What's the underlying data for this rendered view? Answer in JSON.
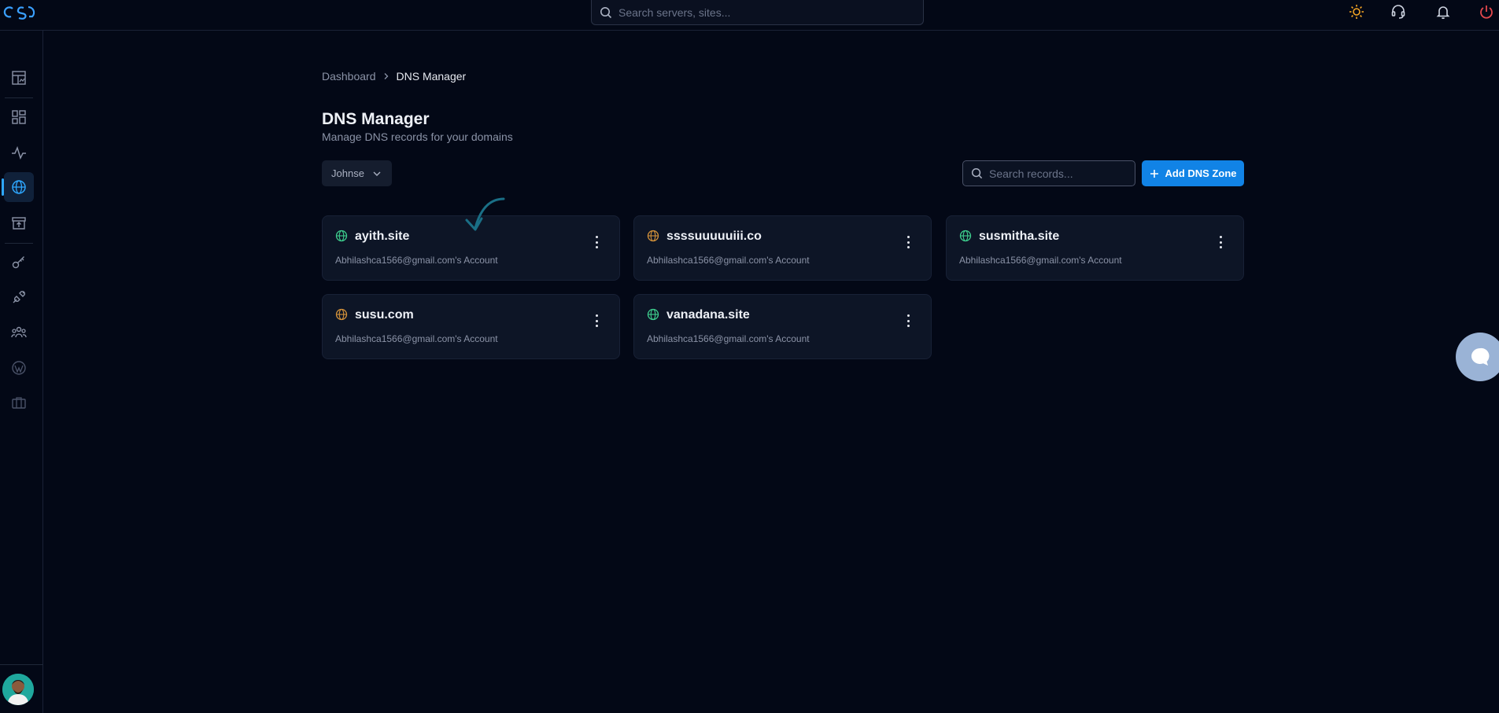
{
  "topbar": {
    "search_placeholder": "Search servers, sites...",
    "icons": [
      "sun-icon",
      "headset-icon",
      "bell-icon",
      "power-icon"
    ]
  },
  "sidebar": {
    "items": [
      {
        "name": "reports",
        "icon": "chart-board-icon"
      },
      {
        "name": "dashboard",
        "icon": "grid-icon"
      },
      {
        "name": "monitoring",
        "icon": "activity-icon"
      },
      {
        "name": "dns",
        "icon": "globe-icon",
        "active": true
      },
      {
        "name": "backups",
        "icon": "archive-upload-icon"
      },
      {
        "name": "keys",
        "icon": "key-icon"
      },
      {
        "name": "integrations",
        "icon": "plug-icon"
      },
      {
        "name": "team",
        "icon": "users-icon"
      },
      {
        "name": "wordpress",
        "icon": "wordpress-icon"
      },
      {
        "name": "briefcase",
        "icon": "briefcase-icon"
      }
    ]
  },
  "breadcrumb": {
    "home": "Dashboard",
    "current": "DNS Manager"
  },
  "page": {
    "title": "DNS Manager",
    "subtitle": "Manage DNS records for your domains"
  },
  "toolbar": {
    "filter_value": "Johnse",
    "search_placeholder": "Search records...",
    "add_label": "Add DNS Zone"
  },
  "zones": [
    {
      "domain": "ayith.site",
      "account": "Abhilashca1566@gmail.com's Account",
      "status_color": "#3ecf8e"
    },
    {
      "domain": "ssssuuuuuiii.co",
      "account": "Abhilashca1566@gmail.com's Account",
      "status_color": "#d4923a"
    },
    {
      "domain": "susmitha.site",
      "account": "Abhilashca1566@gmail.com's Account",
      "status_color": "#3ecf8e"
    },
    {
      "domain": "susu.com",
      "account": "Abhilashca1566@gmail.com's Account",
      "status_color": "#d4923a"
    },
    {
      "domain": "vanadana.site",
      "account": "Abhilashca1566@gmail.com's Account",
      "status_color": "#3ecf8e"
    }
  ],
  "colors": {
    "background": "#030816",
    "card": "#0d1526",
    "accent": "#1183e6",
    "active": "#2ea7ff"
  }
}
